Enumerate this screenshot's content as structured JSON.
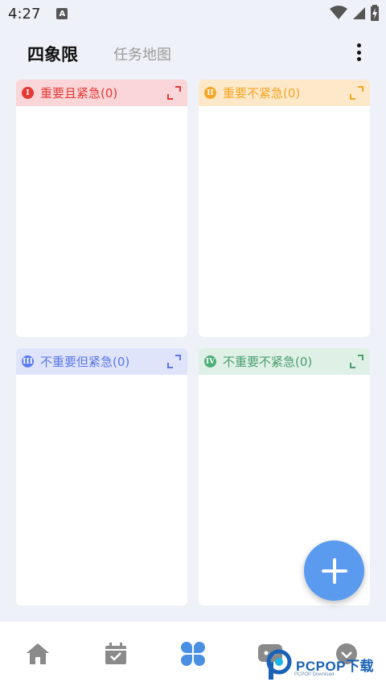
{
  "status_bar": {
    "time": "4:27",
    "notification_letter": "A"
  },
  "header": {
    "active_tab": "四象限",
    "inactive_tab": "任务地图"
  },
  "quadrants": [
    {
      "badge": "I",
      "title": "重要且紧急(0)",
      "color": "#e53935"
    },
    {
      "badge": "II",
      "title": "重要不紧急(0)",
      "color": "#f5a623"
    },
    {
      "badge": "III",
      "title": "不重要但紧急(0)",
      "color": "#5a78e6"
    },
    {
      "badge": "IV",
      "title": "不重要不紧急(0)",
      "color": "#4a9e70"
    }
  ],
  "fab": {
    "icon": "plus-icon",
    "color": "#5a9bef"
  },
  "bottom_nav": {
    "items": [
      {
        "icon": "home-icon",
        "active": false
      },
      {
        "icon": "calendar-check-icon",
        "active": false
      },
      {
        "icon": "four-petal-icon",
        "active": true
      },
      {
        "icon": "chat-icon",
        "active": false
      },
      {
        "icon": "profile-icon",
        "active": false
      }
    ],
    "active_color": "#4a90e2",
    "inactive_color": "#8a8a8a"
  },
  "watermark": {
    "text": "PCPOP下载",
    "sub": "PCPOP Download"
  }
}
